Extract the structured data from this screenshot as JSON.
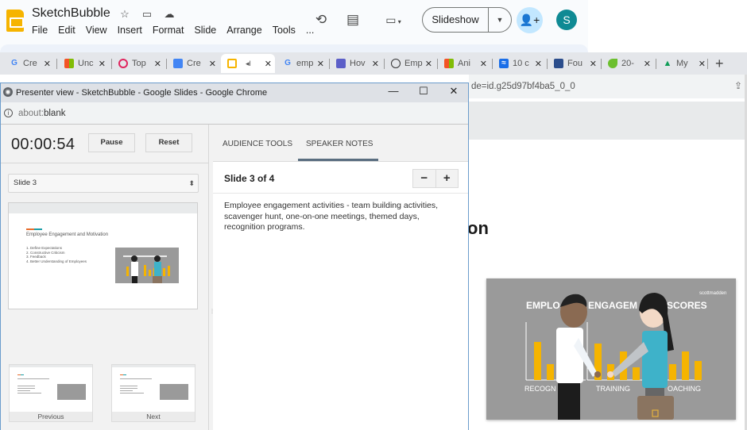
{
  "app": {
    "doc_title": "SketchBubble",
    "title_icons": [
      "star-icon",
      "move-to-folder-icon",
      "cloud-saved-icon"
    ],
    "menu": [
      "File",
      "Edit",
      "View",
      "Insert",
      "Format",
      "Slide",
      "Arrange",
      "Tools",
      "..."
    ],
    "slideshow_label": "Slideshow",
    "avatar_initial": "S",
    "colors": {
      "brand": "#f6b400",
      "avatar": "#0f8a94",
      "share": "#c2e7ff"
    }
  },
  "tabs": [
    {
      "icon": "google-icon",
      "label": "Cre"
    },
    {
      "icon": "microsoft-icon",
      "label": "Unc"
    },
    {
      "icon": "top-icon",
      "label": "Top"
    },
    {
      "icon": "docs-icon",
      "label": "Cre"
    },
    {
      "icon": "slides-icon",
      "label": "",
      "active": true,
      "audio": true
    },
    {
      "icon": "google-icon",
      "label": "emp"
    },
    {
      "icon": "how-icon",
      "label": "Hov"
    },
    {
      "icon": "timer-icon",
      "label": "Emp"
    },
    {
      "icon": "microsoft-icon",
      "label": "Ani"
    },
    {
      "icon": "wave-icon",
      "label": "10 c"
    },
    {
      "icon": "fou-icon",
      "label": "Fou"
    },
    {
      "icon": "leaf-icon",
      "label": "20-"
    },
    {
      "icon": "drive-icon",
      "label": "My"
    }
  ],
  "main_page": {
    "url_fragment": "de=id.g25d97bf4ba5_0_0",
    "heading_fragment": "on",
    "illustration": {
      "heading": "EMPLOYEE ENGAGEMENT SCORES",
      "heading_visible": [
        "EMPLO",
        "ENGAGEM",
        "SCORES"
      ],
      "labels": [
        "RECOGN",
        "TRAINING",
        "OACHING"
      ],
      "logo": "scottmadden"
    }
  },
  "presenter": {
    "window_title": "Presenter view - SketchBubble - Google Slides - Google Chrome",
    "url_prefix": "about:",
    "url_rest": "blank",
    "timer": "00:00:54",
    "pause_label": "Pause",
    "reset_label": "Reset",
    "slide_select": "Slide 3",
    "current_slide": {
      "title": "Employee Engagement and Motivation",
      "items": [
        "1.  Define Expectations",
        "2.  Constructive Criticism",
        "3.  Feedback",
        "4.  Better Understanding of Employees"
      ]
    },
    "previous_label": "Previous",
    "next_label": "Next",
    "tabs": [
      "AUDIENCE TOOLS",
      "SPEAKER NOTES"
    ],
    "active_tab": "SPEAKER NOTES",
    "slide_counter": "Slide 3 of 4",
    "zoom_minus": "−",
    "zoom_plus": "+",
    "speaker_notes": "Employee engagement activities - team building activities, scavenger hunt, one-on-one meetings, themed days, recognition programs."
  }
}
